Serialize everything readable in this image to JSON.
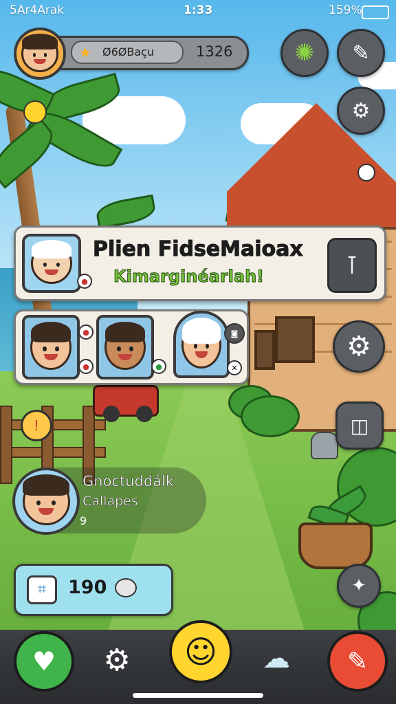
{
  "status_bar": {
    "carrier": "5Ar4Arak",
    "time": "1:33",
    "battery": "159%"
  },
  "header": {
    "currency_label": "Ø6ØBaçu",
    "score": "1326"
  },
  "banner": {
    "title_line1": "Plien FidseMaioax",
    "title_line2": "Kimarginéarlah!"
  },
  "profile": {
    "name": "Gnoctuddálk",
    "subtitle": "Callapes",
    "small_text": "9"
  },
  "chat_box": {
    "count": "190"
  },
  "colors": {
    "accent_green": "#79c23a",
    "heart_button": "#3fb44a",
    "center_button": "#ffd52e",
    "pencil_button": "#e94b34",
    "chat_box_bg": "#9fe0ef"
  },
  "icons": {
    "sun": "sun-icon",
    "edit": "edit-icon",
    "settings": "gear-icon",
    "heart": "heart-icon",
    "smile": "smile-icon",
    "cloud": "cloud-icon",
    "pencil": "pencil-icon"
  }
}
